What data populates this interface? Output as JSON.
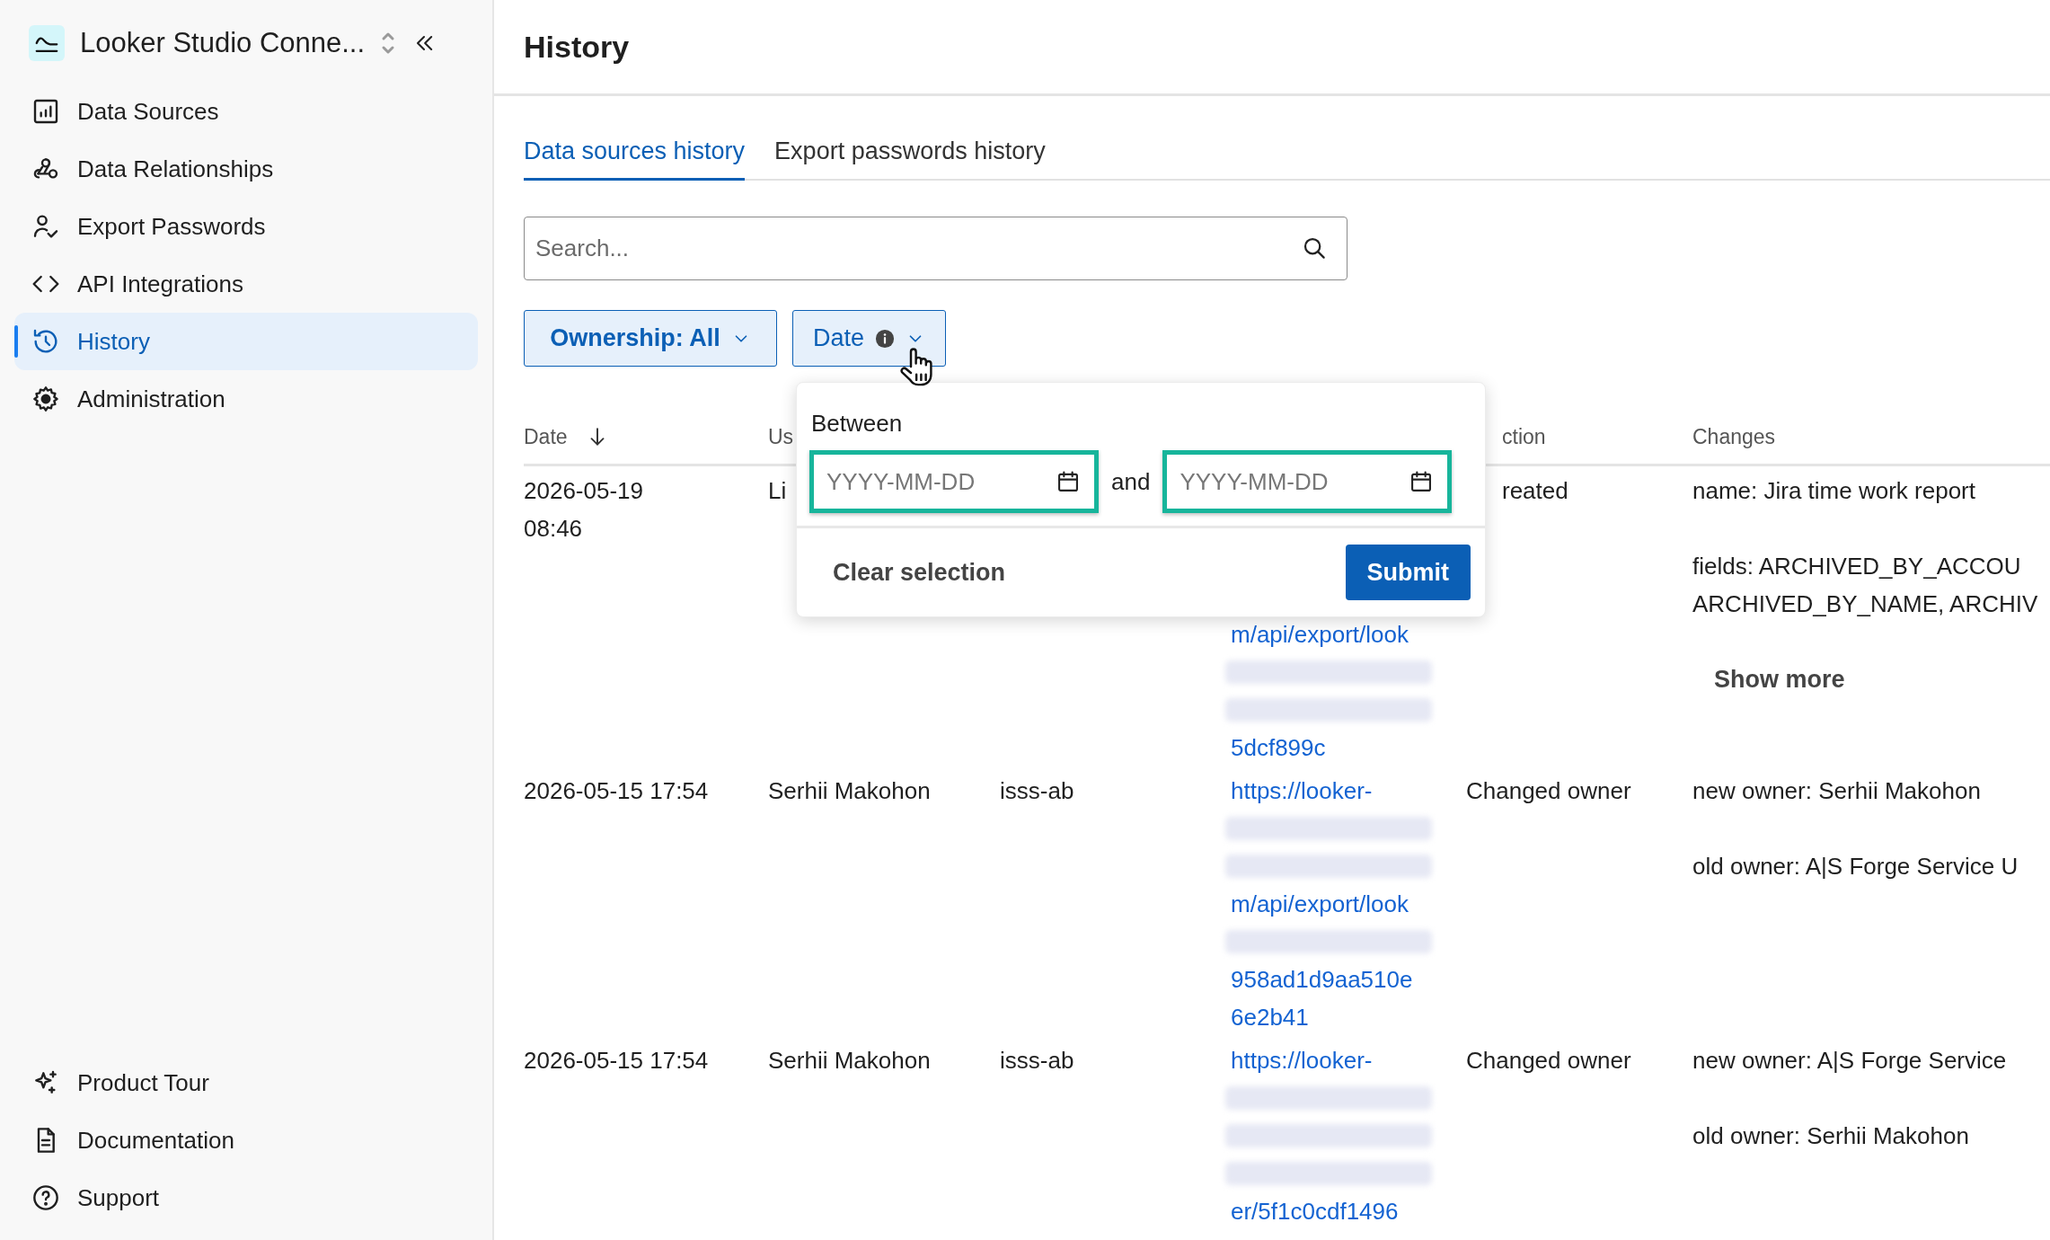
{
  "sidebar": {
    "app_title": "Looker Studio Conne...",
    "nav_items": [
      {
        "label": "Data Sources",
        "selected": false
      },
      {
        "label": "Data Relationships",
        "selected": false
      },
      {
        "label": "Export Passwords",
        "selected": false
      },
      {
        "label": "API Integrations",
        "selected": false
      },
      {
        "label": "History",
        "selected": true
      },
      {
        "label": "Administration",
        "selected": false
      }
    ],
    "footer_items": [
      {
        "label": "Product Tour"
      },
      {
        "label": "Documentation"
      },
      {
        "label": "Support"
      }
    ]
  },
  "page": {
    "title": "History"
  },
  "tabs": [
    {
      "label": "Data sources history",
      "selected": true
    },
    {
      "label": "Export passwords history",
      "selected": false
    }
  ],
  "search": {
    "placeholder": "Search..."
  },
  "filters": [
    {
      "label": "Ownership: All",
      "applied": true,
      "info": false,
      "expanded": false
    },
    {
      "label": "Date",
      "applied": false,
      "info": true,
      "expanded": true
    }
  ],
  "date_popup": {
    "label": "Between",
    "inputs": [
      {
        "placeholder": "YYYY-MM-DD",
        "highlighted": true
      },
      {
        "placeholder": "YYYY-MM-DD",
        "highlighted": true
      }
    ],
    "joiner": "and",
    "clear": "Clear selection",
    "submit": "Submit"
  },
  "table": {
    "columns": [
      {
        "label": "Date",
        "sorted": true,
        "descending": true
      },
      {
        "label": "Us"
      },
      {},
      {},
      {
        "label": "ction"
      },
      {
        "label": "Changes"
      }
    ],
    "rows": [
      {
        "date": [
          "2026-05-19",
          "08:46"
        ],
        "user": "Li",
        "link": [
          {
            "kind": "text",
            "text": "m/api/export/look"
          },
          {
            "kind": "redacted"
          },
          {
            "kind": "redacted"
          },
          {
            "kind": "text",
            "text": "5dcf899c"
          }
        ],
        "action": "reated",
        "changes": [
          {
            "kind": "text",
            "lines": [
              "name: Jira time work report"
            ]
          },
          {
            "kind": "text",
            "lines": [
              "fields: ARCHIVED_BY_ACCOU",
              "ARCHIVED_BY_NAME, ARCHIV"
            ]
          },
          {
            "kind": "button",
            "label": "Show more"
          }
        ]
      },
      {
        "date": [
          "2026-05-15 17:54"
        ],
        "user": "Serhii Makohon",
        "column_3": "isss-ab",
        "link": [
          {
            "kind": "text",
            "text": "https://looker-"
          },
          {
            "kind": "redacted"
          },
          {
            "kind": "redacted"
          },
          {
            "kind": "text",
            "text": "m/api/export/look"
          },
          {
            "kind": "redacted"
          },
          {
            "kind": "text",
            "text": "958ad1d9aa510e"
          },
          {
            "kind": "text",
            "text": "6e2b41"
          }
        ],
        "action": "Changed owner",
        "changes": [
          {
            "kind": "text",
            "lines": [
              "new owner: Serhii Makohon"
            ]
          },
          {
            "kind": "text",
            "lines": [
              "old owner: A|S Forge Service U"
            ]
          }
        ]
      },
      {
        "date": [
          "2026-05-15 17:54"
        ],
        "user": "Serhii Makohon",
        "column_3": "isss-ab",
        "link": [
          {
            "kind": "text",
            "text": "https://looker-"
          },
          {
            "kind": "redacted"
          },
          {
            "kind": "redacted"
          },
          {
            "kind": "redacted"
          },
          {
            "kind": "text",
            "text": "er/5f1c0cdf1496"
          }
        ],
        "action": "Changed owner",
        "changes": [
          {
            "kind": "text",
            "lines": [
              "new owner: A|S Forge Service"
            ]
          },
          {
            "kind": "text",
            "lines": [
              "old owner: Serhii Makohon"
            ]
          }
        ]
      }
    ]
  }
}
